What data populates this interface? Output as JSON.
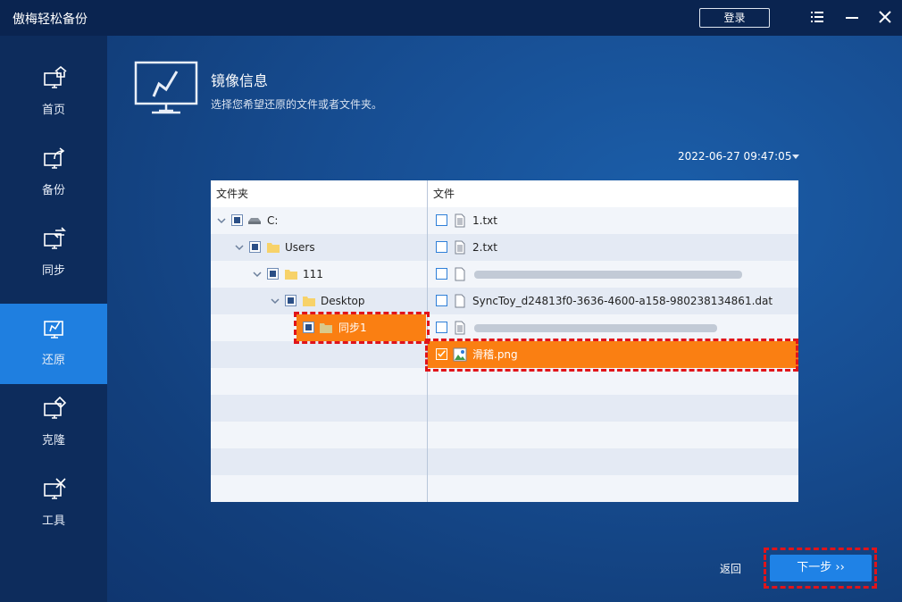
{
  "app": {
    "title": "傲梅轻松备份",
    "login_label": "登录"
  },
  "sidebar": {
    "items": [
      {
        "label": "首页",
        "icon": "home-icon"
      },
      {
        "label": "备份",
        "icon": "backup-icon"
      },
      {
        "label": "同步",
        "icon": "sync-icon"
      },
      {
        "label": "还原",
        "icon": "restore-icon",
        "active": true
      },
      {
        "label": "克隆",
        "icon": "clone-icon"
      },
      {
        "label": "工具",
        "icon": "tools-icon"
      }
    ]
  },
  "header": {
    "title": "镜像信息",
    "subtitle": "选择您希望还原的文件或者文件夹。"
  },
  "date_select": {
    "value": "2022-06-27 09:47:05"
  },
  "table": {
    "folder_header": "文件夹",
    "file_header": "文件",
    "tree": [
      {
        "label": "C:",
        "icon": "drive-icon",
        "level": 0,
        "check": "partial"
      },
      {
        "label": "Users",
        "icon": "folder-icon",
        "level": 1,
        "check": "partial"
      },
      {
        "label": "111",
        "icon": "folder-icon",
        "level": 2,
        "check": "partial"
      },
      {
        "label": "Desktop",
        "icon": "folder-icon",
        "level": 3,
        "check": "partial"
      },
      {
        "label": "同步1",
        "icon": "folder-icon",
        "level": 4,
        "check": "partial",
        "selected": true
      }
    ],
    "files": [
      {
        "name": "1.txt",
        "icon": "text-file-icon",
        "checked": false
      },
      {
        "name": "2.txt",
        "icon": "text-file-icon",
        "checked": false
      },
      {
        "name": "",
        "icon": "file-icon",
        "checked": false,
        "blurred": true
      },
      {
        "name": "SyncToy_d24813f0-3636-4600-a158-980238134861.dat",
        "icon": "file-icon",
        "checked": false
      },
      {
        "name": "",
        "icon": "text-file-icon",
        "checked": false,
        "blurred": true
      },
      {
        "name": "滑稽.png",
        "icon": "image-file-icon",
        "checked": true,
        "selected": true
      }
    ]
  },
  "footer": {
    "back_label": "返回",
    "next_label": "下一步 ››"
  },
  "colors": {
    "accent": "#1f82e6",
    "selection": "#fa7f12",
    "highlight_border": "#e0141a"
  }
}
